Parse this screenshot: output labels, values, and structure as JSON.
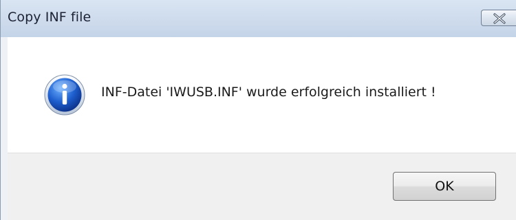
{
  "dialog": {
    "title": "Copy INF file",
    "message": "INF-Datei 'IWUSB.INF' wurde erfolgreich installiert !",
    "icon": "info-icon",
    "ok_label": "OK",
    "close_icon": "close-icon"
  },
  "colors": {
    "titlebar": "#cfdced",
    "icon_blue": "#1f5bbf",
    "button_bar": "#f0f0f0"
  }
}
